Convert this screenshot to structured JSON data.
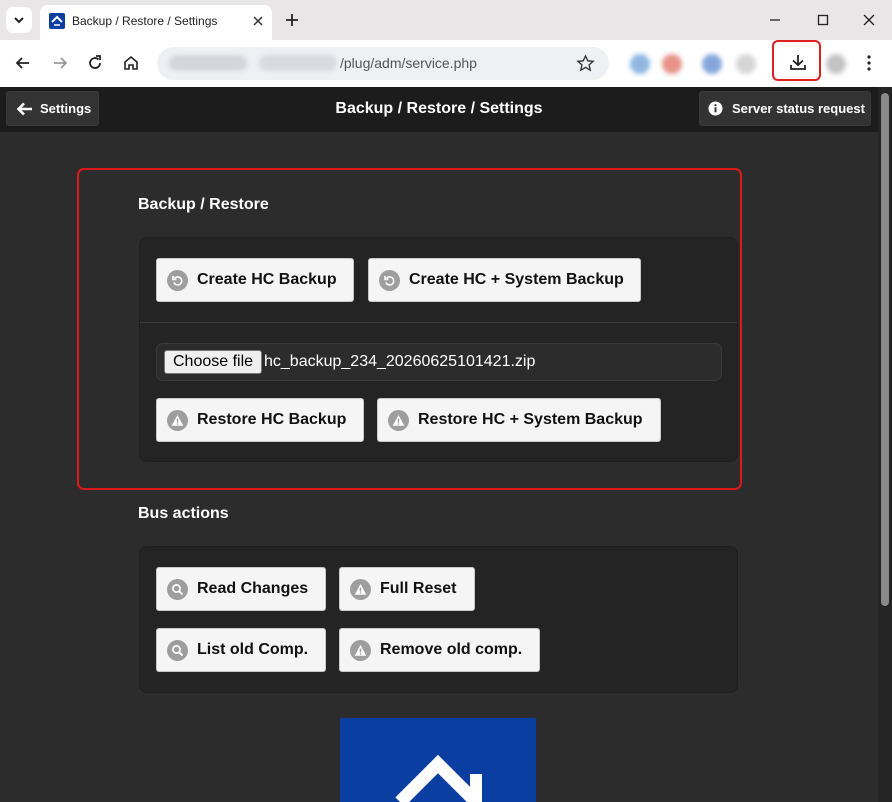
{
  "browser": {
    "tab_title": "Backup / Restore / Settings",
    "url_path": "/plug/adm/service.php"
  },
  "header": {
    "back_label": "Settings",
    "title": "Backup / Restore / Settings",
    "status_label": "Server status request"
  },
  "backup_section": {
    "title": "Backup / Restore",
    "create_hc_label": "Create HC Backup",
    "create_hc_system_label": "Create HC + System Backup",
    "choose_file_label": "Choose file",
    "file_name": "hc_backup_234_20260625101421.zip",
    "restore_hc_label": "Restore HC Backup",
    "restore_hc_system_label": "Restore HC + System Backup"
  },
  "bus_section": {
    "title": "Bus actions",
    "read_changes_label": "Read Changes",
    "full_reset_label": "Full Reset",
    "list_old_label": "List old Comp.",
    "remove_old_label": "Remove old comp."
  },
  "colors": {
    "page_bg": "#2c2c2c",
    "highlight": "#dd1a1a",
    "logo_blue": "#0a3ea0"
  }
}
